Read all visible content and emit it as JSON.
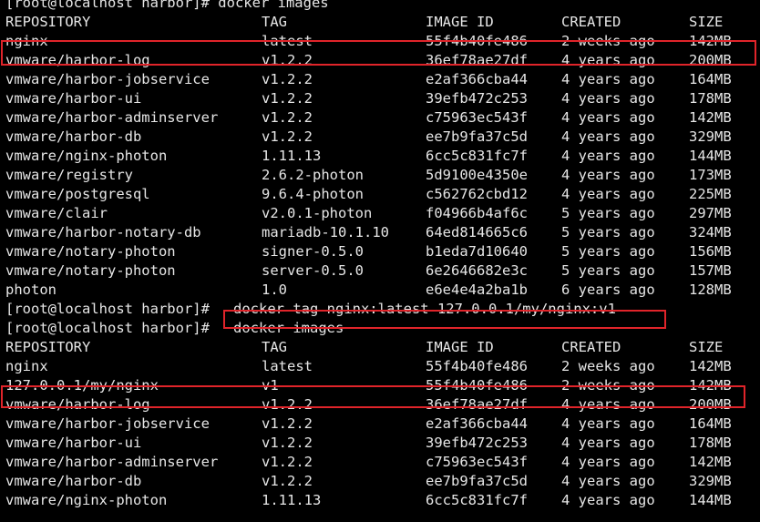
{
  "terminal": {
    "prompt": "[root@localhost harbor]#",
    "partial_top": "[root@localhost harbor]# docker images",
    "command_1": "docker images",
    "command_2": "docker tag nginx:latest 127.0.0.1/my/nginx:v1",
    "command_3": "docker images"
  },
  "headers": [
    "REPOSITORY",
    "TAG",
    "IMAGE ID",
    "CREATED",
    "SIZE"
  ],
  "table1": [
    [
      "nginx",
      "latest",
      "55f4b40fe486",
      "2 weeks ago",
      "142MB"
    ],
    [
      "vmware/harbor-log",
      "v1.2.2",
      "36ef78ae27df",
      "4 years ago",
      "200MB"
    ],
    [
      "vmware/harbor-jobservice",
      "v1.2.2",
      "e2af366cba44",
      "4 years ago",
      "164MB"
    ],
    [
      "vmware/harbor-ui",
      "v1.2.2",
      "39efb472c253",
      "4 years ago",
      "178MB"
    ],
    [
      "vmware/harbor-adminserver",
      "v1.2.2",
      "c75963ec543f",
      "4 years ago",
      "142MB"
    ],
    [
      "vmware/harbor-db",
      "v1.2.2",
      "ee7b9fa37c5d",
      "4 years ago",
      "329MB"
    ],
    [
      "vmware/nginx-photon",
      "1.11.13",
      "6cc5c831fc7f",
      "4 years ago",
      "144MB"
    ],
    [
      "vmware/registry",
      "2.6.2-photon",
      "5d9100e4350e",
      "4 years ago",
      "173MB"
    ],
    [
      "vmware/postgresql",
      "9.6.4-photon",
      "c562762cbd12",
      "4 years ago",
      "225MB"
    ],
    [
      "vmware/clair",
      "v2.0.1-photon",
      "f04966b4af6c",
      "5 years ago",
      "297MB"
    ],
    [
      "vmware/harbor-notary-db",
      "mariadb-10.1.10",
      "64ed814665c6",
      "5 years ago",
      "324MB"
    ],
    [
      "vmware/notary-photon",
      "signer-0.5.0",
      "b1eda7d10640",
      "5 years ago",
      "156MB"
    ],
    [
      "vmware/notary-photon",
      "server-0.5.0",
      "6e2646682e3c",
      "5 years ago",
      "157MB"
    ],
    [
      "photon",
      "1.0",
      "e6e4e4a2ba1b",
      "6 years ago",
      "128MB"
    ]
  ],
  "table2": [
    [
      "nginx",
      "latest",
      "55f4b40fe486",
      "2 weeks ago",
      "142MB"
    ],
    [
      "127.0.0.1/my/nginx",
      "v1",
      "55f4b40fe486",
      "2 weeks ago",
      "142MB"
    ],
    [
      "vmware/harbor-log",
      "v1.2.2",
      "36ef78ae27df",
      "4 years ago",
      "200MB"
    ],
    [
      "vmware/harbor-jobservice",
      "v1.2.2",
      "e2af366cba44",
      "4 years ago",
      "164MB"
    ],
    [
      "vmware/harbor-ui",
      "v1.2.2",
      "39efb472c253",
      "4 years ago",
      "178MB"
    ],
    [
      "vmware/harbor-adminserver",
      "v1.2.2",
      "c75963ec543f",
      "4 years ago",
      "142MB"
    ],
    [
      "vmware/harbor-db",
      "v1.2.2",
      "ee7b9fa37c5d",
      "4 years ago",
      "329MB"
    ],
    [
      "vmware/nginx-photon",
      "1.11.13",
      "6cc5c831fc7f",
      "4 years ago",
      "144MB"
    ]
  ],
  "colors": {
    "background": "#000000",
    "text": "#e6e6e6",
    "highlight": "#e0242a"
  }
}
